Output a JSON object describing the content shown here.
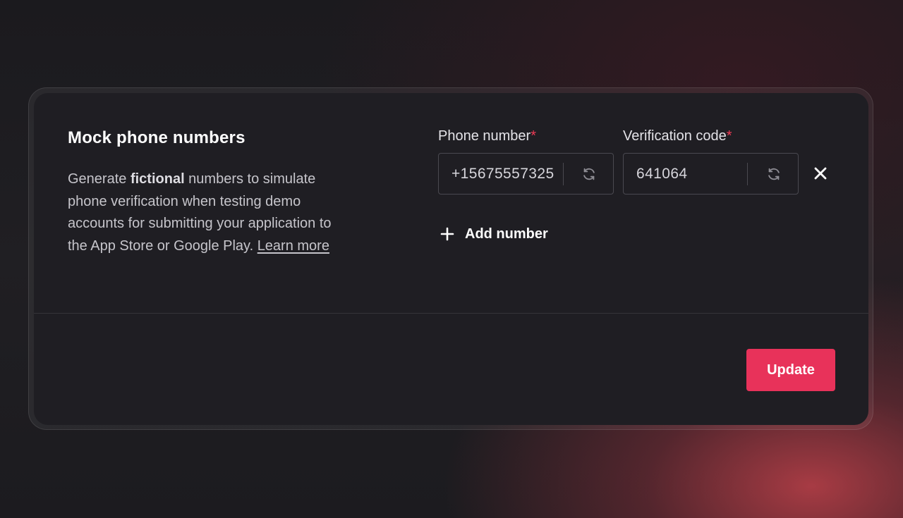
{
  "section": {
    "title": "Mock phone numbers",
    "description_pre": "Generate ",
    "description_bold": "fictional",
    "description_post": " numbers to simulate phone verification when testing demo accounts for submitting your application to the App Store or Google Play. ",
    "learn_more": "Learn more"
  },
  "fields": {
    "phone_label": "Phone number",
    "code_label": "Verification code",
    "required_marker": "*",
    "phone_value": "+15675557325",
    "code_value": "641064"
  },
  "actions": {
    "add_number": "Add number",
    "update": "Update"
  },
  "icons": {
    "refresh": "refresh-icon",
    "close": "close-icon",
    "plus": "plus-icon"
  },
  "colors": {
    "accent": "#e8325a",
    "required": "#ee3a55"
  }
}
